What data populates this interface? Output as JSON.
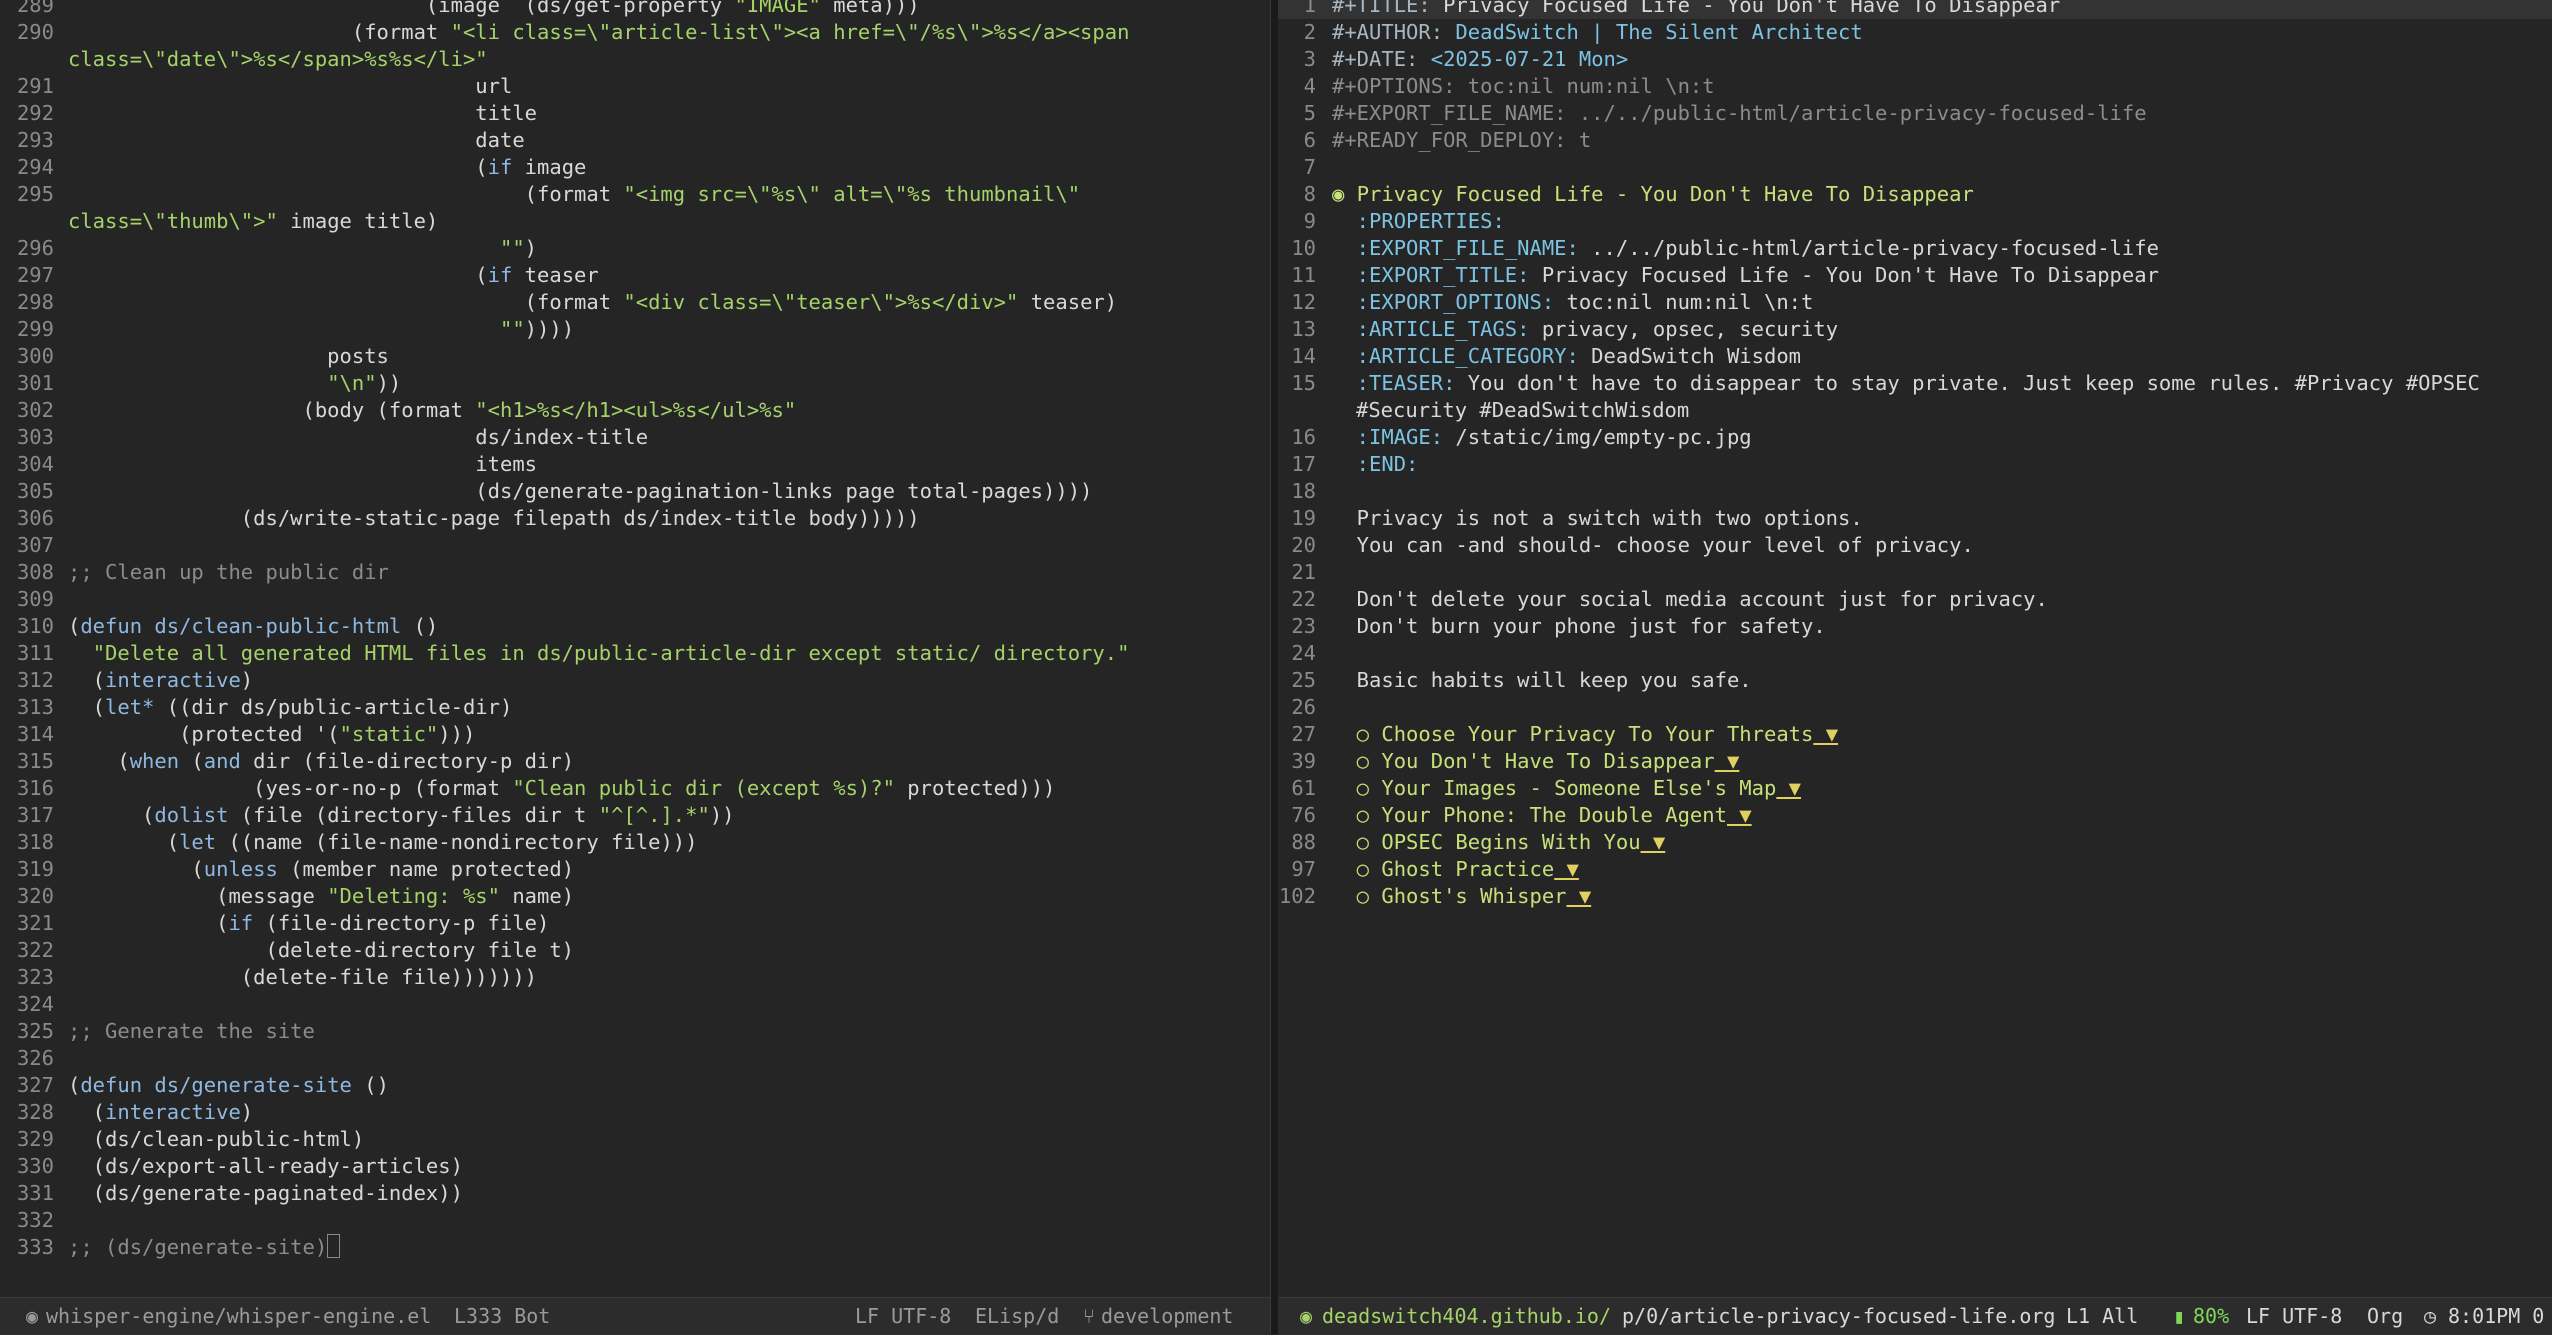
{
  "left_pane": {
    "lines": [
      {
        "n": "289",
        "parts": [
          {
            "t": "                             (image  (ds/get-property ",
            "c": ""
          },
          {
            "t": "\"IMAGE\"",
            "c": "str"
          },
          {
            "t": " meta)))",
            "c": ""
          }
        ]
      },
      {
        "n": "290",
        "parts": [
          {
            "t": "                       (format ",
            "c": ""
          },
          {
            "t": "\"<li class=\\\"article-list\\\"><a href=\\\"/%s\\\">%s</a><span",
            "c": "str"
          }
        ],
        "wrap": [
          {
            "t": "class=\\\"date\\\">%s</span>%s%s</li>\"",
            "c": "str"
          }
        ]
      },
      {
        "n": "291",
        "parts": [
          {
            "t": "                                 url",
            "c": ""
          }
        ]
      },
      {
        "n": "292",
        "parts": [
          {
            "t": "                                 title",
            "c": ""
          }
        ]
      },
      {
        "n": "293",
        "parts": [
          {
            "t": "                                 date",
            "c": ""
          }
        ]
      },
      {
        "n": "294",
        "parts": [
          {
            "t": "                                 (",
            "c": ""
          },
          {
            "t": "if",
            "c": "kw"
          },
          {
            "t": " image",
            "c": ""
          }
        ]
      },
      {
        "n": "295",
        "parts": [
          {
            "t": "                                     (format ",
            "c": ""
          },
          {
            "t": "\"<img src=\\\"%s\\\" alt=\\\"%s thumbnail\\\"",
            "c": "str"
          }
        ],
        "wrap": [
          {
            "t": "class=\\\"thumb\\\">\"",
            "c": "str"
          },
          {
            "t": " image title)",
            "c": ""
          }
        ]
      },
      {
        "n": "296",
        "parts": [
          {
            "t": "                                   ",
            "c": ""
          },
          {
            "t": "\"\"",
            "c": "str"
          },
          {
            "t": ")",
            "c": ""
          }
        ]
      },
      {
        "n": "297",
        "parts": [
          {
            "t": "                                 (",
            "c": ""
          },
          {
            "t": "if",
            "c": "kw"
          },
          {
            "t": " teaser",
            "c": ""
          }
        ]
      },
      {
        "n": "298",
        "parts": [
          {
            "t": "                                     (format ",
            "c": ""
          },
          {
            "t": "\"<div class=\\\"teaser\\\">%s</div>\"",
            "c": "str"
          },
          {
            "t": " teaser)",
            "c": ""
          }
        ]
      },
      {
        "n": "299",
        "parts": [
          {
            "t": "                                   ",
            "c": ""
          },
          {
            "t": "\"\"",
            "c": "str"
          },
          {
            "t": "))))",
            "c": ""
          }
        ]
      },
      {
        "n": "300",
        "parts": [
          {
            "t": "                     posts",
            "c": ""
          }
        ]
      },
      {
        "n": "301",
        "parts": [
          {
            "t": "                     ",
            "c": ""
          },
          {
            "t": "\"\\n\"",
            "c": "str"
          },
          {
            "t": "))",
            "c": ""
          }
        ]
      },
      {
        "n": "302",
        "parts": [
          {
            "t": "                   (body (format ",
            "c": ""
          },
          {
            "t": "\"<h1>%s</h1><ul>%s</ul>%s\"",
            "c": "str"
          }
        ]
      },
      {
        "n": "303",
        "parts": [
          {
            "t": "                                 ds/index-title",
            "c": ""
          }
        ]
      },
      {
        "n": "304",
        "parts": [
          {
            "t": "                                 items",
            "c": ""
          }
        ]
      },
      {
        "n": "305",
        "parts": [
          {
            "t": "                                 (ds/generate-pagination-links page total-pages))))",
            "c": ""
          }
        ]
      },
      {
        "n": "306",
        "parts": [
          {
            "t": "              (ds/write-static-page filepath ds/index-title body)))))",
            "c": ""
          }
        ]
      },
      {
        "n": "307",
        "parts": [
          {
            "t": "",
            "c": ""
          }
        ]
      },
      {
        "n": "308",
        "parts": [
          {
            "t": ";; Clean up the public dir",
            "c": "cm"
          }
        ]
      },
      {
        "n": "309",
        "parts": [
          {
            "t": "",
            "c": ""
          }
        ]
      },
      {
        "n": "310",
        "parts": [
          {
            "t": "(",
            "c": ""
          },
          {
            "t": "defun",
            "c": "kw"
          },
          {
            "t": " ",
            "c": ""
          },
          {
            "t": "ds/clean-public-html",
            "c": "kw"
          },
          {
            "t": " ()",
            "c": ""
          }
        ]
      },
      {
        "n": "311",
        "parts": [
          {
            "t": "  ",
            "c": ""
          },
          {
            "t": "\"Delete all generated HTML files in ds/public-article-dir except static/ directory.\"",
            "c": "str"
          }
        ]
      },
      {
        "n": "312",
        "parts": [
          {
            "t": "  (",
            "c": ""
          },
          {
            "t": "interactive",
            "c": "kw"
          },
          {
            "t": ")",
            "c": ""
          }
        ]
      },
      {
        "n": "313",
        "parts": [
          {
            "t": "  (",
            "c": ""
          },
          {
            "t": "let*",
            "c": "kw"
          },
          {
            "t": " ((dir ds/public-article-dir)",
            "c": ""
          }
        ]
      },
      {
        "n": "314",
        "parts": [
          {
            "t": "         (protected '(",
            "c": ""
          },
          {
            "t": "\"static\"",
            "c": "str"
          },
          {
            "t": ")))",
            "c": ""
          }
        ]
      },
      {
        "n": "315",
        "parts": [
          {
            "t": "    (",
            "c": ""
          },
          {
            "t": "when",
            "c": "kw"
          },
          {
            "t": " (",
            "c": ""
          },
          {
            "t": "and",
            "c": "kw"
          },
          {
            "t": " dir (file-directory-p dir)",
            "c": ""
          }
        ]
      },
      {
        "n": "316",
        "parts": [
          {
            "t": "               (yes-or-no-p (format ",
            "c": ""
          },
          {
            "t": "\"Clean public dir (except %s)?\"",
            "c": "str"
          },
          {
            "t": " protected)))",
            "c": ""
          }
        ]
      },
      {
        "n": "317",
        "parts": [
          {
            "t": "      (",
            "c": ""
          },
          {
            "t": "dolist",
            "c": "kw"
          },
          {
            "t": " (file (directory-files dir t ",
            "c": ""
          },
          {
            "t": "\"^[^.].*\"",
            "c": "str"
          },
          {
            "t": "))",
            "c": ""
          }
        ]
      },
      {
        "n": "318",
        "parts": [
          {
            "t": "        (",
            "c": ""
          },
          {
            "t": "let",
            "c": "kw"
          },
          {
            "t": " ((name (file-name-nondirectory file)))",
            "c": ""
          }
        ]
      },
      {
        "n": "319",
        "parts": [
          {
            "t": "          (",
            "c": ""
          },
          {
            "t": "unless",
            "c": "kw"
          },
          {
            "t": " (member name protected)",
            "c": ""
          }
        ]
      },
      {
        "n": "320",
        "parts": [
          {
            "t": "            (message ",
            "c": ""
          },
          {
            "t": "\"Deleting: %s\"",
            "c": "str"
          },
          {
            "t": " name)",
            "c": ""
          }
        ]
      },
      {
        "n": "321",
        "parts": [
          {
            "t": "            (",
            "c": ""
          },
          {
            "t": "if",
            "c": "kw"
          },
          {
            "t": " (file-directory-p file)",
            "c": ""
          }
        ]
      },
      {
        "n": "322",
        "parts": [
          {
            "t": "                (delete-directory file t)",
            "c": ""
          }
        ]
      },
      {
        "n": "323",
        "parts": [
          {
            "t": "              (delete-file file)))))))",
            "c": ""
          }
        ]
      },
      {
        "n": "324",
        "parts": [
          {
            "t": "",
            "c": ""
          }
        ]
      },
      {
        "n": "325",
        "parts": [
          {
            "t": ";; Generate the site",
            "c": "cm"
          }
        ]
      },
      {
        "n": "326",
        "parts": [
          {
            "t": "",
            "c": ""
          }
        ]
      },
      {
        "n": "327",
        "parts": [
          {
            "t": "(",
            "c": ""
          },
          {
            "t": "defun",
            "c": "kw"
          },
          {
            "t": " ",
            "c": ""
          },
          {
            "t": "ds/generate-site",
            "c": "kw"
          },
          {
            "t": " ()",
            "c": ""
          }
        ]
      },
      {
        "n": "328",
        "parts": [
          {
            "t": "  (",
            "c": ""
          },
          {
            "t": "interactive",
            "c": "kw"
          },
          {
            "t": ")",
            "c": ""
          }
        ]
      },
      {
        "n": "329",
        "parts": [
          {
            "t": "  (ds/clean-public-html)",
            "c": ""
          }
        ]
      },
      {
        "n": "330",
        "parts": [
          {
            "t": "  (ds/export-all-ready-articles)",
            "c": ""
          }
        ]
      },
      {
        "n": "331",
        "parts": [
          {
            "t": "  (ds/generate-paginated-index))",
            "c": ""
          }
        ]
      },
      {
        "n": "332",
        "parts": [
          {
            "t": "",
            "c": ""
          }
        ]
      },
      {
        "n": "333",
        "parts": [
          {
            "t": ";; (ds/generate-site)",
            "c": "cm"
          }
        ],
        "cursor": true
      }
    ]
  },
  "right_pane": {
    "lines": [
      {
        "n": "1",
        "parts": [
          {
            "t": "#+TITLE: ",
            "c": "meta"
          },
          {
            "t": "Privacy Focused Life - You Don't Have To Disappear",
            "c": "ml-white"
          }
        ],
        "current": true
      },
      {
        "n": "2",
        "parts": [
          {
            "t": "#+AUTHOR: ",
            "c": "meta"
          },
          {
            "t": "DeadSwitch | The Silent Architect",
            "c": "lnk"
          }
        ]
      },
      {
        "n": "3",
        "parts": [
          {
            "t": "#+DATE: ",
            "c": "meta"
          },
          {
            "t": "<2025-07-21 Mon>",
            "c": "date"
          }
        ]
      },
      {
        "n": "4",
        "parts": [
          {
            "t": "#+OPTIONS: toc:nil num:nil \\n:t",
            "c": "dim"
          }
        ]
      },
      {
        "n": "5",
        "parts": [
          {
            "t": "#+EXPORT_FILE_NAME: ../../public-html/article-privacy-focused-life",
            "c": "dim"
          }
        ]
      },
      {
        "n": "6",
        "parts": [
          {
            "t": "#+READY_FOR_DEPLOY: t",
            "c": "dim"
          }
        ]
      },
      {
        "n": "7",
        "parts": [
          {
            "t": "",
            "c": ""
          }
        ]
      },
      {
        "n": "8",
        "parts": [
          {
            "t": "◉ ",
            "c": "bullet"
          },
          {
            "t": "Privacy Focused Life - You Don't Have To Disappear",
            "c": "head1"
          }
        ]
      },
      {
        "n": "9",
        "parts": [
          {
            "t": "  :PROPERTIES:",
            "c": "prop"
          }
        ]
      },
      {
        "n": "10",
        "parts": [
          {
            "t": "  :EXPORT_FILE_NAME:",
            "c": "prop"
          },
          {
            "t": " ../../public-html/article-privacy-focused-life",
            "c": ""
          }
        ]
      },
      {
        "n": "11",
        "parts": [
          {
            "t": "  :EXPORT_TITLE:",
            "c": "prop"
          },
          {
            "t": " Privacy Focused Life - You Don't Have To Disappear",
            "c": ""
          }
        ]
      },
      {
        "n": "12",
        "parts": [
          {
            "t": "  :EXPORT_OPTIONS:",
            "c": "prop"
          },
          {
            "t": " toc:nil num:nil \\n:t",
            "c": ""
          }
        ]
      },
      {
        "n": "13",
        "parts": [
          {
            "t": "  :ARTICLE_TAGS:",
            "c": "prop"
          },
          {
            "t": " privacy, opsec, security",
            "c": ""
          }
        ]
      },
      {
        "n": "14",
        "parts": [
          {
            "t": "  :ARTICLE_CATEGORY:",
            "c": "prop"
          },
          {
            "t": " DeadSwitch Wisdom",
            "c": ""
          }
        ]
      },
      {
        "n": "15",
        "parts": [
          {
            "t": "  :TEASER:",
            "c": "prop"
          },
          {
            "t": " You don't have to disappear to stay private. Just keep some rules. #Privacy #OPSEC",
            "c": ""
          }
        ],
        "wrap": [
          {
            "t": "#Security #DeadSwitchWisdom",
            "c": ""
          }
        ]
      },
      {
        "n": "16",
        "parts": [
          {
            "t": "  :IMAGE:",
            "c": "prop"
          },
          {
            "t": " /static/img/empty-pc.jpg",
            "c": ""
          }
        ]
      },
      {
        "n": "17",
        "parts": [
          {
            "t": "  :END:",
            "c": "prop"
          }
        ]
      },
      {
        "n": "18",
        "parts": [
          {
            "t": "",
            "c": ""
          }
        ]
      },
      {
        "n": "19",
        "parts": [
          {
            "t": "  Privacy is not a switch with two options.",
            "c": ""
          }
        ]
      },
      {
        "n": "20",
        "parts": [
          {
            "t": "  You can -and should- choose your level of privacy.",
            "c": ""
          }
        ]
      },
      {
        "n": "21",
        "parts": [
          {
            "t": "",
            "c": ""
          }
        ]
      },
      {
        "n": "22",
        "parts": [
          {
            "t": "  Don't delete your social media account just for privacy.",
            "c": ""
          }
        ]
      },
      {
        "n": "23",
        "parts": [
          {
            "t": "  Don't burn your phone just for safety.",
            "c": ""
          }
        ]
      },
      {
        "n": "24",
        "parts": [
          {
            "t": "",
            "c": ""
          }
        ]
      },
      {
        "n": "25",
        "parts": [
          {
            "t": "  Basic habits will keep you safe.",
            "c": ""
          }
        ]
      },
      {
        "n": "26",
        "parts": [
          {
            "t": "",
            "c": ""
          }
        ]
      },
      {
        "n": "27",
        "parts": [
          {
            "t": "  ○ ",
            "c": "bullet"
          },
          {
            "t": "Choose Your Privacy To Your Threats",
            "c": "head2"
          },
          {
            "t": " ▼",
            "c": "arrow"
          }
        ]
      },
      {
        "n": "39",
        "parts": [
          {
            "t": "  ○ ",
            "c": "bullet"
          },
          {
            "t": "You Don't Have To Disappear",
            "c": "head2"
          },
          {
            "t": " ▼",
            "c": "arrow"
          }
        ]
      },
      {
        "n": "61",
        "parts": [
          {
            "t": "  ○ ",
            "c": "bullet"
          },
          {
            "t": "Your Images - Someone Else's Map",
            "c": "head2"
          },
          {
            "t": " ▼",
            "c": "arrow"
          }
        ]
      },
      {
        "n": "76",
        "parts": [
          {
            "t": "  ○ ",
            "c": "bullet"
          },
          {
            "t": "Your Phone: The Double Agent",
            "c": "head2"
          },
          {
            "t": " ▼",
            "c": "arrow"
          }
        ]
      },
      {
        "n": "88",
        "parts": [
          {
            "t": "  ○ ",
            "c": "bullet"
          },
          {
            "t": "OPSEC Begins With You",
            "c": "head2"
          },
          {
            "t": " ▼",
            "c": "arrow"
          }
        ]
      },
      {
        "n": "97",
        "parts": [
          {
            "t": "  ○ ",
            "c": "bullet"
          },
          {
            "t": "Ghost Practice",
            "c": "head2"
          },
          {
            "t": " ▼",
            "c": "arrow"
          }
        ]
      },
      {
        "n": "102",
        "parts": [
          {
            "t": "  ○ ",
            "c": "bullet"
          },
          {
            "t": "Ghost's Whisper",
            "c": "head2"
          },
          {
            "t": " ▼",
            "c": "arrow"
          }
        ]
      }
    ]
  },
  "modeline_left": {
    "buffer": "whisper-engine/whisper-engine.el",
    "position": "L333 Bot",
    "encoding": "LF UTF-8",
    "mode": "ELisp/d",
    "branch": "development"
  },
  "modeline_right": {
    "host": "deadswitch404.github.io/",
    "path": "p/0/article-privacy-focused-life.org",
    "position": "L1 All",
    "battery": "80%",
    "encoding": "LF UTF-8",
    "mode": "Org",
    "time": "8:01PM 0"
  },
  "colors": {
    "background": "#252525",
    "keyword": "#8fb8e0",
    "string": "#a5d36a",
    "comment": "#8c8c8c",
    "heading": "#c8e07a",
    "property": "#7cc3e3"
  }
}
